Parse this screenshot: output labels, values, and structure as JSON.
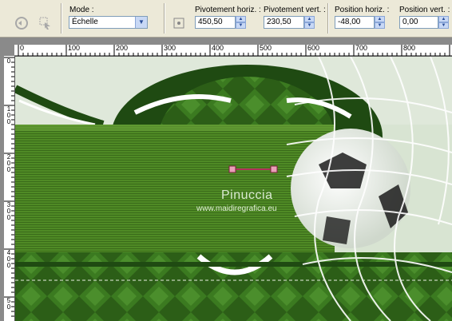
{
  "toolbar": {
    "mode_label": "Mode :",
    "mode_value": "Échelle",
    "pivot_h_label": "Pivotement horiz. :",
    "pivot_h_value": "450,50",
    "pivot_v_label": "Pivotement vert. :",
    "pivot_v_value": "230,50",
    "pos_h_label": "Position horiz. :",
    "pos_h_value": "-48,00",
    "pos_v_label": "Position vert. :",
    "pos_v_value": "0,00"
  },
  "ruler_top": [
    "0",
    "100",
    "200",
    "300",
    "400",
    "500",
    "600",
    "700",
    "800"
  ],
  "ruler_left": [
    "0",
    "1\n0\n0",
    "2\n0\n0",
    "3\n0\n0",
    "4\n0\n0",
    "5\n0"
  ],
  "canvas": {
    "watermark_title": "Pinuccia",
    "watermark_url": "www.maidiregrafica.eu"
  },
  "colors": {
    "toolbar_bg": "#ece9d8",
    "green_band": "#4e8a25",
    "dark_green": "#1f4a12",
    "light_bg": "#d8e4d2"
  }
}
